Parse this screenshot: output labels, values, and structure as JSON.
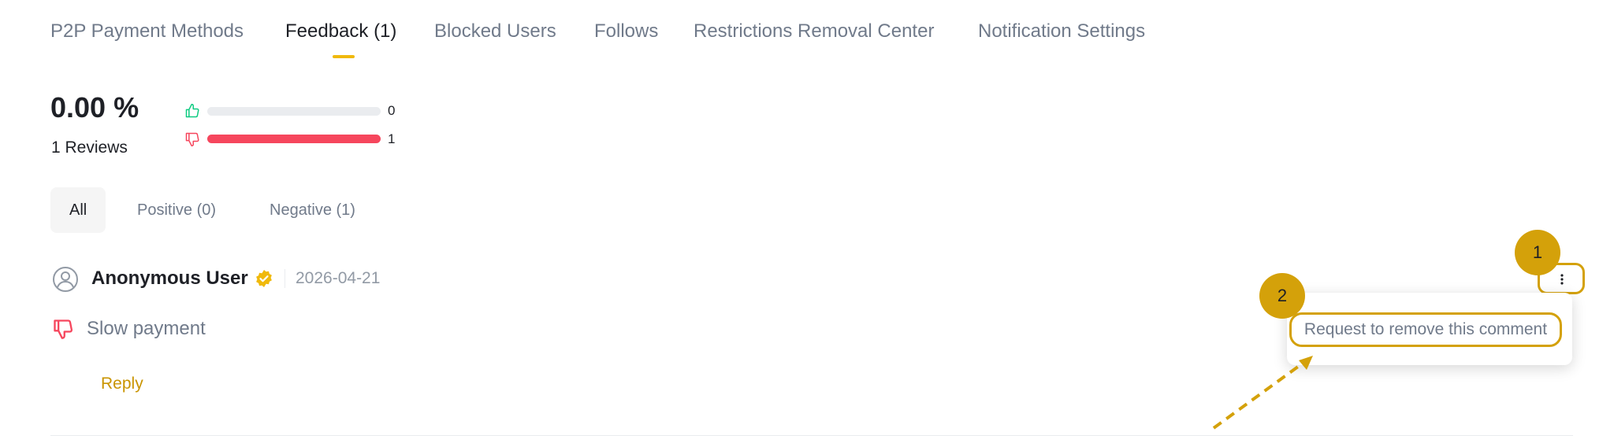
{
  "tabs": [
    {
      "label": "P2P Payment Methods",
      "active": false
    },
    {
      "label": "Feedback (1)",
      "active": true
    },
    {
      "label": "Blocked Users",
      "active": false
    },
    {
      "label": "Follows",
      "active": false
    },
    {
      "label": "Restrictions Removal Center",
      "active": false
    },
    {
      "label": "Notification Settings",
      "active": false
    }
  ],
  "summary": {
    "percentage": "0.00 %",
    "reviews_label": "1 Reviews",
    "positive": {
      "count": "0",
      "fraction": 0
    },
    "negative": {
      "count": "1",
      "fraction": 1
    }
  },
  "filters": [
    {
      "label": "All",
      "active": true
    },
    {
      "label": "Positive (0)",
      "active": false
    },
    {
      "label": "Negative (1)",
      "active": false
    }
  ],
  "review": {
    "user": "Anonymous User",
    "date": "2026-04-21",
    "sentiment": "negative",
    "comment": "Slow payment",
    "reply_label": "Reply"
  },
  "menu": {
    "item_label": "Request to remove this comment"
  },
  "steps": [
    "1",
    "2"
  ],
  "icons": {
    "thumbs_up": "thumbs-up-icon",
    "thumbs_down": "thumbs-down-icon",
    "avatar": "user-avatar-icon",
    "verified": "verified-badge-icon",
    "more": "more-vertical-icon",
    "arrow": "dashed-arrow-icon"
  },
  "colors": {
    "accent": "#f0b90b",
    "highlight": "#d4a10a",
    "link": "#c99400",
    "positive": "#0ecb81",
    "negative": "#f6465d",
    "muted_text": "#707a8a"
  }
}
